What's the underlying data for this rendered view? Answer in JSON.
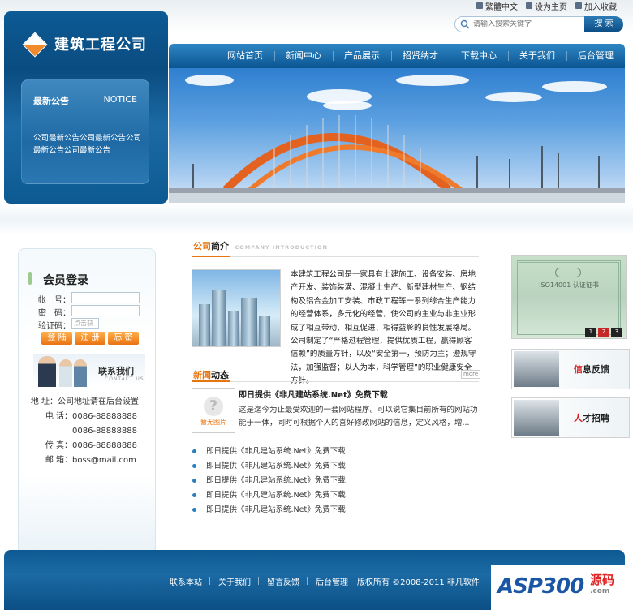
{
  "header": {
    "top_links": [
      "繁體中文",
      "设为主页",
      "加入收藏"
    ],
    "search_placeholder": "请输入搜索关键字",
    "search_button": "搜 索",
    "logo_text": "建筑工程公司"
  },
  "notice": {
    "title": "最新公告",
    "title_en": "NOTICE",
    "content": "公司最新公告公司最新公告公司最新公告公司最新公告"
  },
  "nav": [
    "网站首页",
    "新闻中心",
    "产品展示",
    "招贤纳才",
    "下载中心",
    "关于我们",
    "后台管理"
  ],
  "login": {
    "title": "会员登录",
    "fields": [
      {
        "label": "帐　号："
      },
      {
        "label": "密　码："
      },
      {
        "label": "验证码：",
        "placeholder": "点击获"
      }
    ],
    "buttons": [
      "登 陆",
      "注 册",
      "忘 密"
    ]
  },
  "contact": {
    "title": "联系我们",
    "title_en": "CONTACT US",
    "items": [
      {
        "label": "地 址：",
        "value": "公司地址请在后台设置"
      },
      {
        "label": "电 话：",
        "value": "0086-88888888"
      },
      {
        "label": "",
        "value": "0086-88888888"
      },
      {
        "label": "传 真：",
        "value": "0086-88888888"
      },
      {
        "label": "邮 箱：",
        "value": "boss@mail.com"
      }
    ]
  },
  "intro": {
    "title_a": "公司",
    "title_b": "简介",
    "title_en": "COMPANY INTRODUCTION",
    "text": "本建筑工程公司是一家具有土建施工、设备安装、房地产开发、装饰装潢、混凝土生产、新型建材生产、钢结构及铝合金加工安装、市政工程等一系列综合生产能力的经营体系，多元化的经营，使公司的主业与非主业形成了相互带动、相互促进、相得益彰的良性发展格局。公司制定了“严格过程管理，提供优质工程，赢得顾客信赖”的质量方针，以及“安全第一，预防为主；遵规守法，加强监督；以人为本，科学管理”的职业健康安全方针。"
  },
  "news": {
    "title_a": "新闻",
    "title_b": "动态",
    "more": "more",
    "thumb_text": "暂无图片",
    "headline": "即日提供《非凡建站系统.Net》免费下载",
    "desc": "这是迄今为止最受欢迎的一套网站程序。可以说它集目前所有的网站功能于一体，同时可根据个人的喜好修改网站的信息，定义风格，增...",
    "list": [
      "即日提供《非凡建站系统.Net》免费下载",
      "即日提供《非凡建站系统.Net》免费下载",
      "即日提供《非凡建站系统.Net》免费下载",
      "即日提供《非凡建站系统.Net》免费下载",
      "即日提供《非凡建站系统.Net》免费下载"
    ]
  },
  "right": {
    "cert_text": "ISO14001 认证证书",
    "pages": [
      "1",
      "2",
      "3"
    ],
    "links": [
      {
        "red": "信",
        "rest": "息反馈"
      },
      {
        "red": "人",
        "rest": "才招聘"
      }
    ]
  },
  "footer": {
    "links": [
      "联系本站",
      "关于我们",
      "留言反馈",
      "后台管理"
    ],
    "copyright": "版权所有 ©2008-2011 非凡软件"
  },
  "watermark": {
    "text": "ASP300",
    "cn": "源码",
    "url": ".com"
  }
}
